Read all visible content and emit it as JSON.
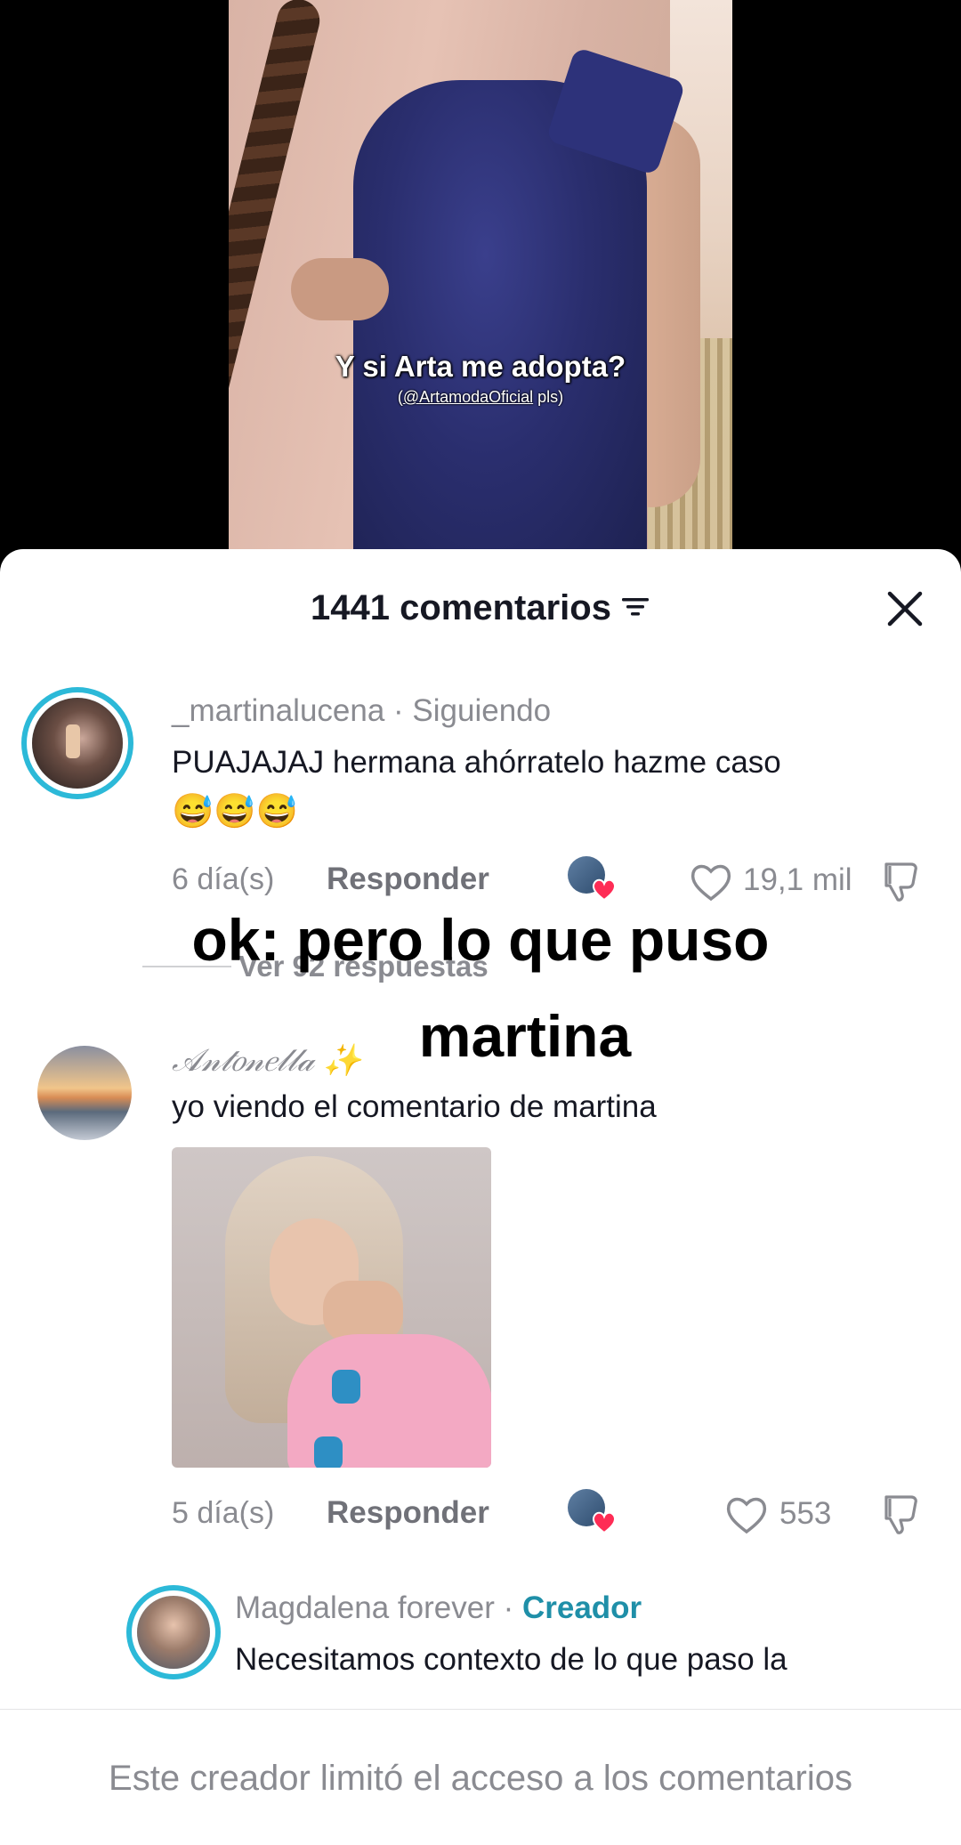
{
  "video": {
    "caption": "Y si Arta me adopta?",
    "subcaption_prefix": "(",
    "subcaption_handle": "@ArtamodaOficial",
    "subcaption_suffix": " pls)"
  },
  "header": {
    "title": "1441 comentarios",
    "filter_icon": "filter-icon",
    "close_icon": "close-icon"
  },
  "overlay": {
    "line1": "ok: pero lo que puso",
    "line2": "martina"
  },
  "comments": [
    {
      "username": "_martinalucena",
      "tag": " · Siguiendo",
      "text": "PUAJAJAJ hermana ahórratelo hazme caso",
      "emoji": "😅😅😅",
      "age": "6 día(s)",
      "reply": "Responder",
      "likes": "19,1 mil",
      "view_replies": "Ver 92 respuestas"
    },
    {
      "username": "𝒜𝓃𝓉𝑜𝓃𝑒𝓁𝓁𝒶 ✨",
      "text": "yo viendo el comentario de martina",
      "age": "5 día(s)",
      "reply": "Responder",
      "likes": "553"
    },
    {
      "username": "Magdalena forever",
      "tag": " · ",
      "creator": "Creador",
      "text": "Necesitamos contexto de lo que paso la"
    }
  ],
  "footer": {
    "notice": "Este creador limitó el acceso a los comentarios"
  },
  "colors": {
    "accent_ring": "#2cb9d8",
    "creator": "#1f8fa8",
    "heart": "#fe2c55"
  }
}
